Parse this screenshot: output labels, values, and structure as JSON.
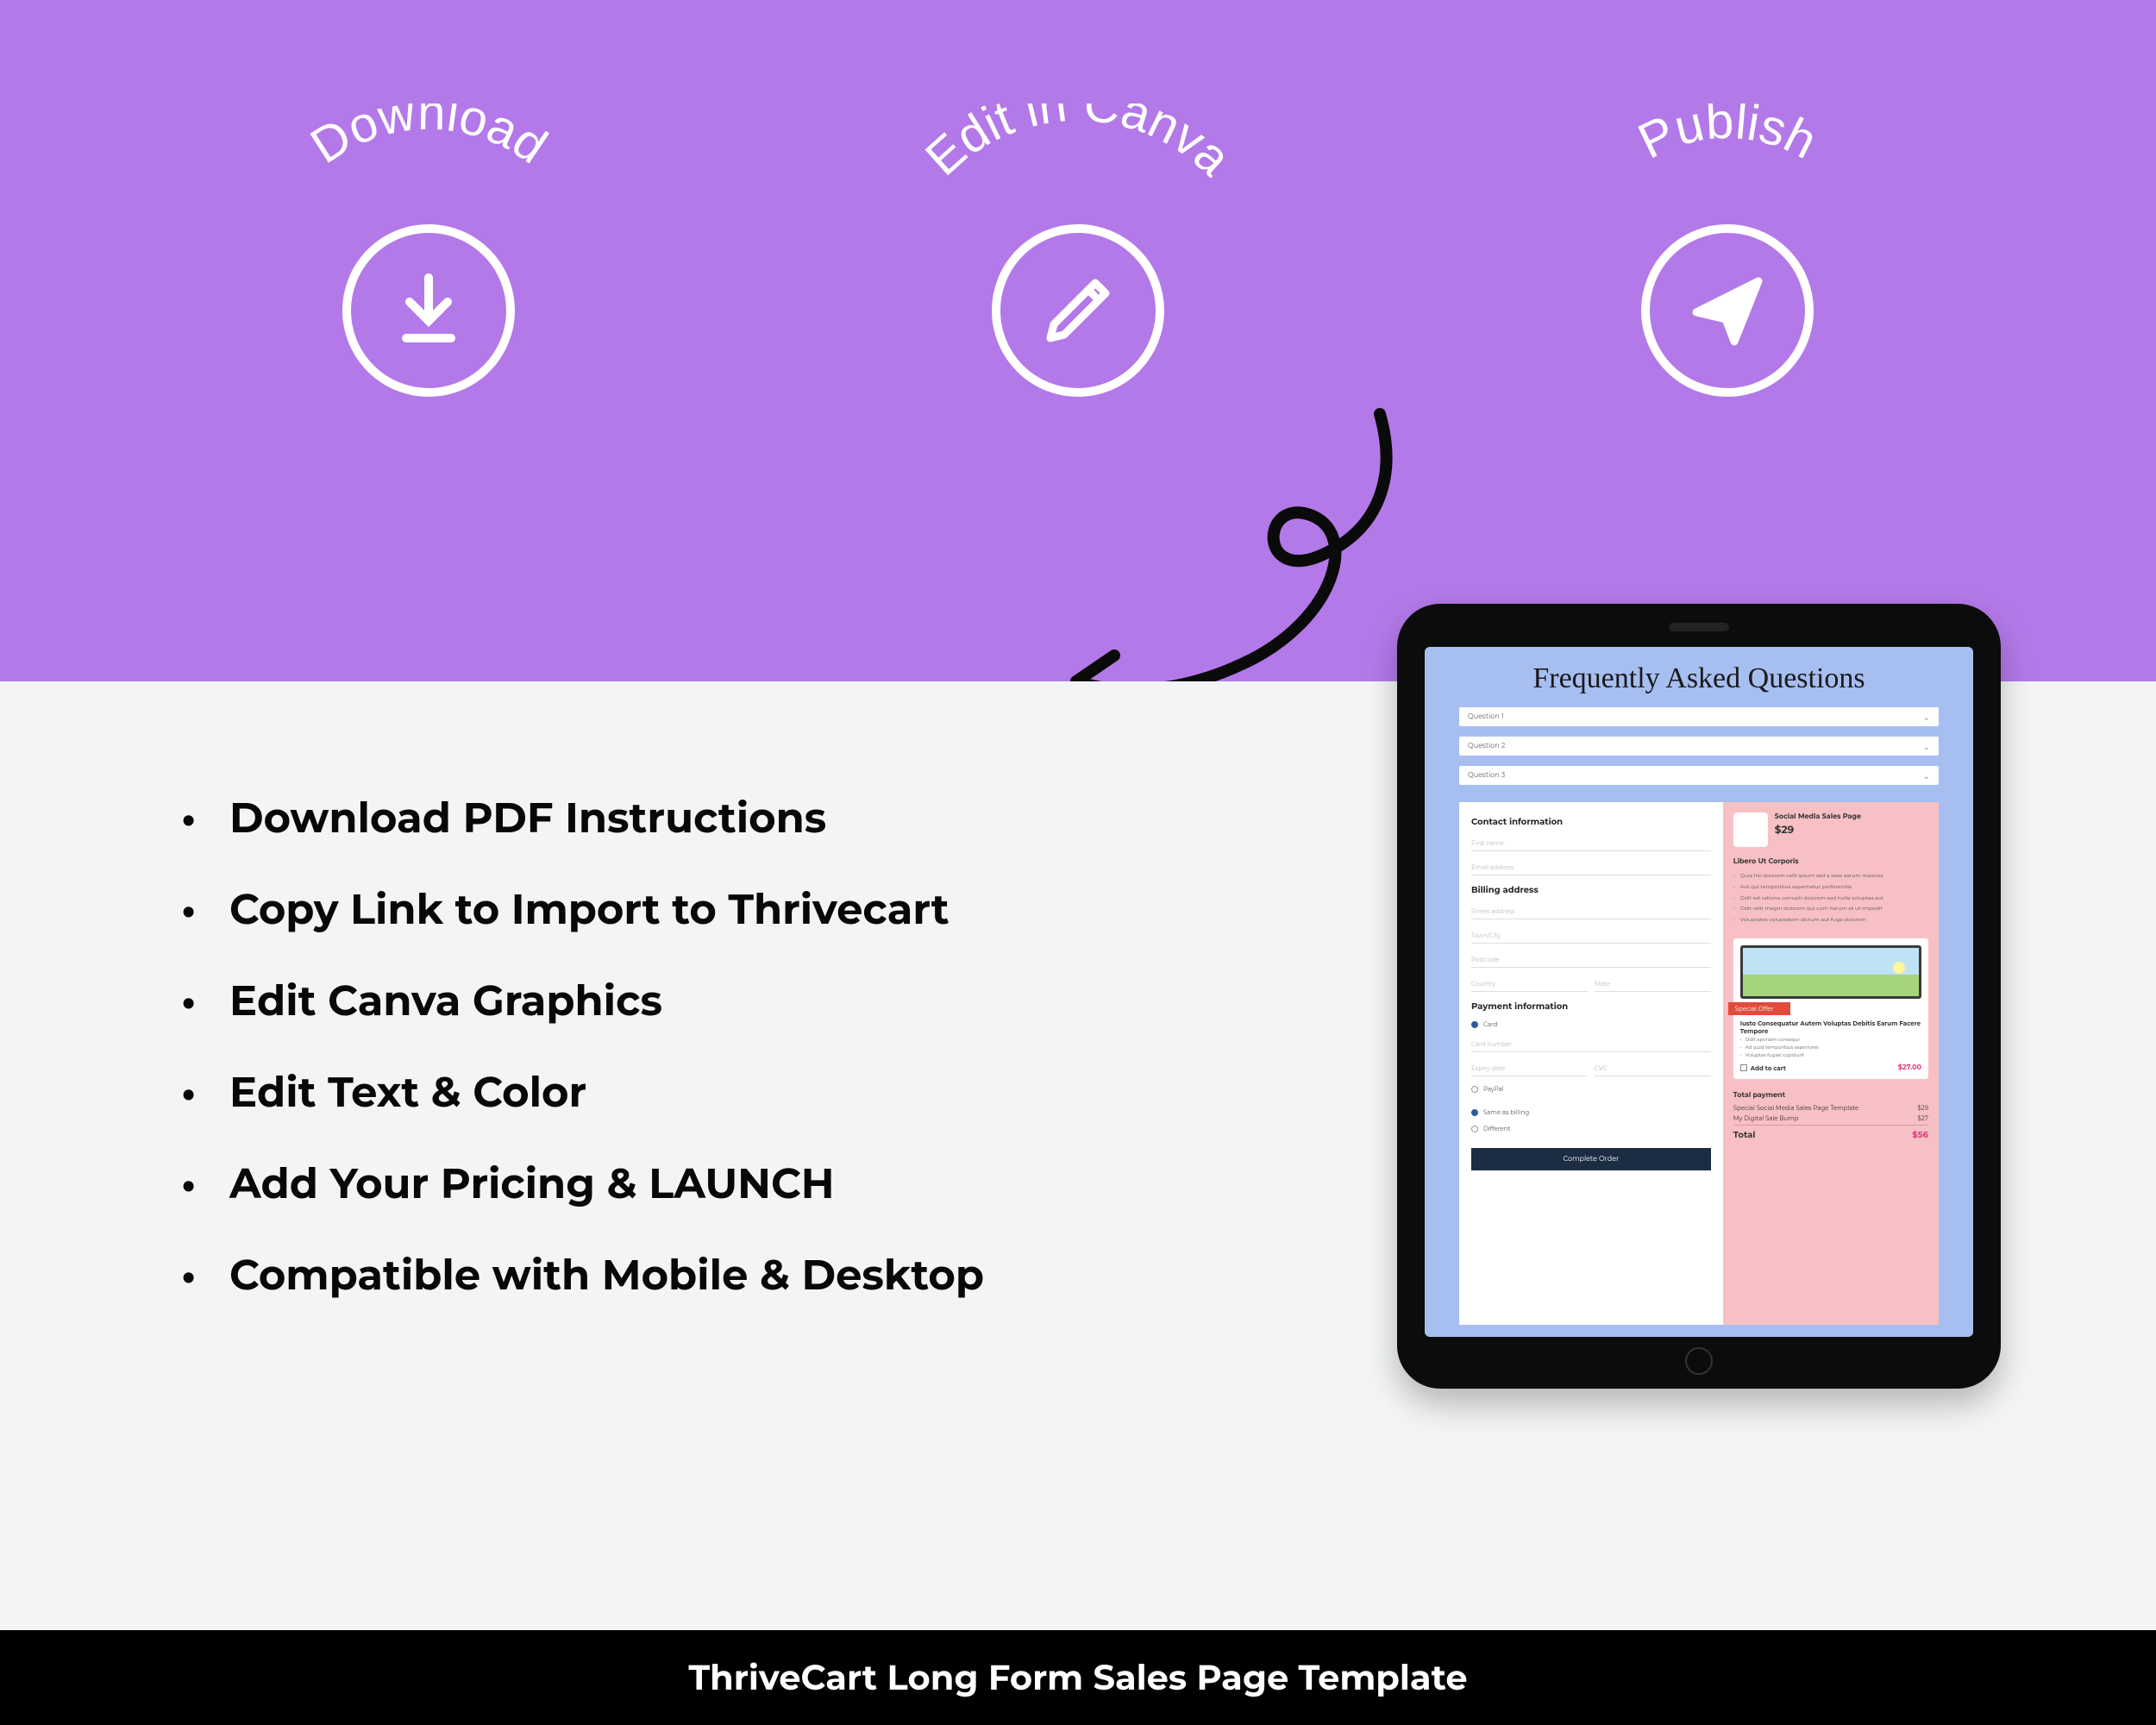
{
  "steps": {
    "download": {
      "label": "Download"
    },
    "edit": {
      "label": "Edit in Canva"
    },
    "publish": {
      "label": "Publish"
    }
  },
  "bullets": [
    "Download PDF Instructions",
    "Copy Link to Import to Thrivecart",
    "Edit Canva Graphics",
    "Edit Text & Color",
    "Add Your Pricing & LAUNCH",
    "Compatible with Mobile & Desktop"
  ],
  "tablet": {
    "faq_title": "Frequently Asked Questions",
    "faq_items": [
      "Question 1",
      "Question 2",
      "Question 3"
    ],
    "contact_heading": "Contact information",
    "contact_fields": [
      "First name",
      "Email address"
    ],
    "billing_heading": "Billing address",
    "billing_fields": [
      "Street address",
      "Town/City",
      "Postcode",
      "Country",
      "State"
    ],
    "payment_heading": "Payment information",
    "pay_options": [
      "Card",
      "PayPal"
    ],
    "card_fields": [
      "Card number",
      "Expiry date",
      "CVC"
    ],
    "ship_options": [
      "Same as billing",
      "Different"
    ],
    "complete_btn": "Complete Order",
    "product": {
      "name": "Social Media Sales Page",
      "price": "$29"
    },
    "right_heading": "Libero Ut Corporis",
    "right_bullets": [
      "Quia hic dolorem velit ipsum sed a esse earum maiores",
      "Aut qui temporibus aspernatur perferendis",
      "Odit est ratione corrupti dolorem sed nulla voluptas aut",
      "Odit velit magni dolorem qui cum harum et ut impedit",
      "Voluptates voluptatem dictum aut fuga dolorem"
    ],
    "offer": {
      "ribbon": "Special Offer",
      "title": "Iusto Consequatur Autem Voluptas Debitis Earum Facere Tempore",
      "bullets": [
        "Odit aperiam consequi",
        "Ad quid temporibus asperiores",
        "Voluptas fugiat cupidunt"
      ],
      "add_label": "Add to cart",
      "price": "$27.00"
    },
    "totals": {
      "label": "Total payment",
      "line1": {
        "k": "Special Social Media Sales Page Template",
        "v": "$29"
      },
      "line2": {
        "k": "My Digital Sale Bump",
        "v": "$27"
      },
      "grand": {
        "k": "Total",
        "v": "$56"
      }
    }
  },
  "footer": "ThriveCart Long Form Sales Page Template",
  "colors": {
    "purple": "#b379e8",
    "black": "#000000",
    "tablet_bg": "#a6bef0",
    "checkout_pink": "#f7c0c5"
  }
}
